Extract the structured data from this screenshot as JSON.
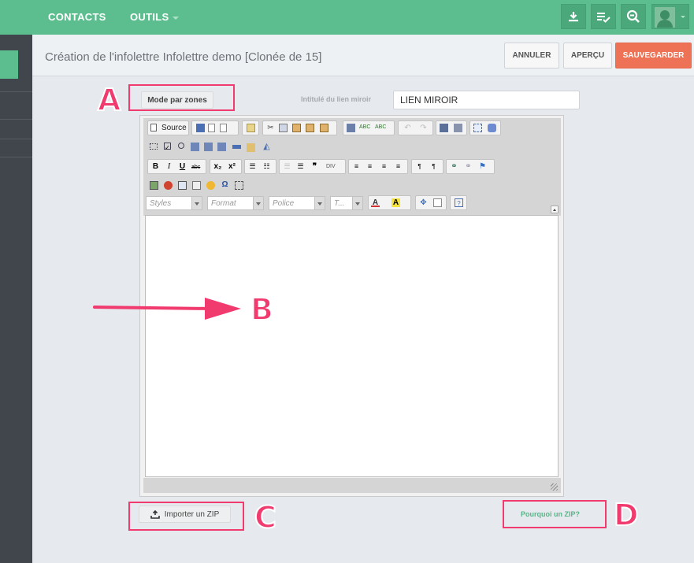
{
  "topbar": {
    "nav": [
      {
        "label": "CONTACTS"
      },
      {
        "label": "OUTILS"
      }
    ],
    "icons": [
      "download-icon",
      "checklist-icon",
      "zoom-out-icon"
    ],
    "brand_color": "#5cbe8e"
  },
  "header": {
    "title": "Création de l'infolettre Infolettre demo [Clonée de 15]",
    "cancel_label": "ANNULER",
    "preview_label": "APERÇU",
    "save_label": "SAUVEGARDER",
    "save_color": "#ee7256"
  },
  "form": {
    "mode_button_label": "Mode par zones",
    "mirror_label": "Intitulé du lien miroir",
    "mirror_value": "LIEN MIROIR"
  },
  "editor": {
    "source_label": "Source",
    "combos": [
      {
        "label": "Styles"
      },
      {
        "label": "Format"
      },
      {
        "label": "Police"
      },
      {
        "label": "T..."
      }
    ]
  },
  "footer": {
    "import_zip_label": "Importer un ZIP",
    "why_zip_label": "Pourquoi un ZIP?"
  },
  "annotations": {
    "a": "A",
    "b": "B",
    "c": "C",
    "d": "D",
    "color": "#f13a6e"
  }
}
